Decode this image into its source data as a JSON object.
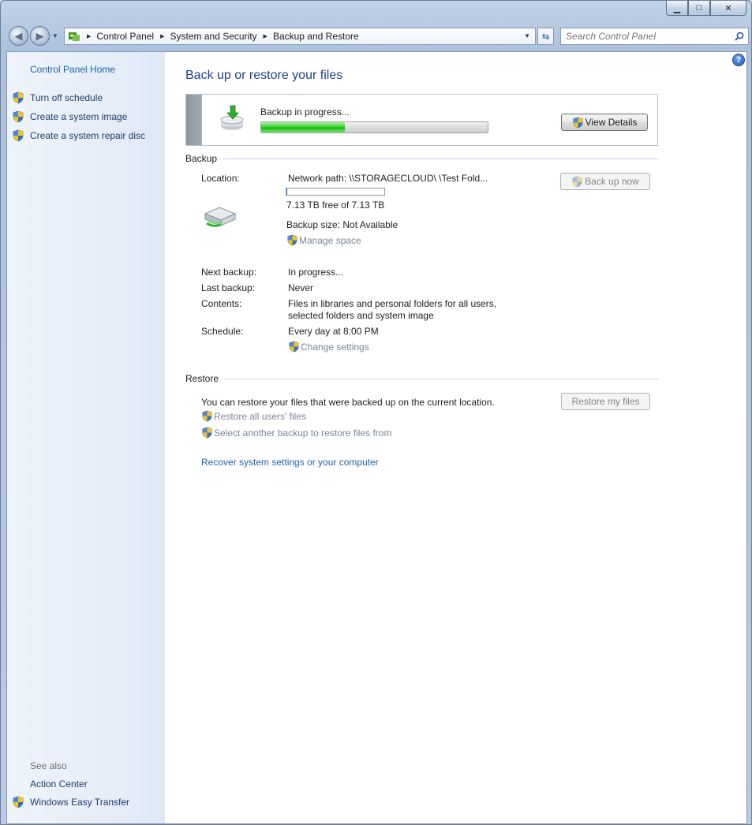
{
  "window": {
    "caption_buttons": {
      "minimize": "▁",
      "maximize": "□",
      "close": "✕"
    }
  },
  "toolbar": {
    "breadcrumbs": [
      "Control Panel",
      "System and Security",
      "Backup and Restore"
    ],
    "search_placeholder": "Search Control Panel"
  },
  "sidebar": {
    "home": "Control Panel Home",
    "items": [
      {
        "label": "Turn off schedule",
        "icon": "uac-shield-icon"
      },
      {
        "label": "Create a system image",
        "icon": "uac-shield-icon"
      },
      {
        "label": "Create a system repair disc",
        "icon": "uac-shield-icon"
      }
    ],
    "see_also_label": "See also",
    "see_also_items": [
      {
        "label": "Action Center"
      },
      {
        "label": "Windows Easy Transfer",
        "icon": "uac-shield-icon"
      }
    ]
  },
  "main": {
    "title": "Back up or restore your files",
    "progress": {
      "label": "Backup in progress...",
      "fraction": 0.37,
      "view_details_label": "View Details"
    },
    "backup": {
      "heading": "Backup",
      "location_label": "Location:",
      "location_value": "Network path: \\\\STORAGECLOUD\\              \\Test Fold...",
      "space_fraction": 0.01,
      "free_space": "7.13 TB free of 7.13 TB",
      "backup_size": "Backup size: Not Available",
      "manage_space": "Manage space",
      "back_up_now": "Back up now",
      "rows": [
        {
          "label": "Next backup:",
          "value": "In progress..."
        },
        {
          "label": "Last backup:",
          "value": "Never"
        },
        {
          "label": "Contents:",
          "value": "Files in libraries and personal folders for all users, selected folders and system image"
        },
        {
          "label": "Schedule:",
          "value": "Every day at 8:00 PM"
        }
      ],
      "change_settings": "Change settings"
    },
    "restore": {
      "heading": "Restore",
      "description": "You can restore your files that were backed up on the current location.",
      "restore_my_files": "Restore my files",
      "restore_all_users": "Restore all users' files",
      "select_another": "Select another backup to restore files from",
      "recover_link": "Recover system settings or your computer"
    }
  },
  "colors": {
    "link": "#1e63b0",
    "link_disabled": "#7a8594",
    "title": "#1e3e8a",
    "progress_green": "#2fc428",
    "sidebar_bg": "#e4edf8"
  }
}
